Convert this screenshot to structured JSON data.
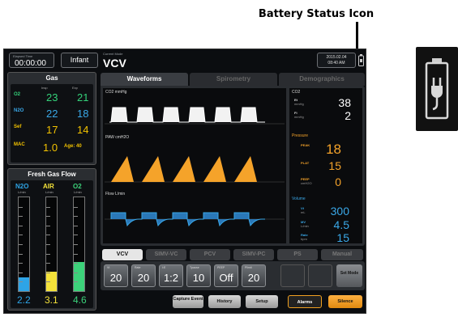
{
  "annotation": {
    "label": "Battery Status Icon"
  },
  "header": {
    "elapsed_label": "Elapsed Time",
    "elapsed_value": "00:00:00",
    "patient_type": "Infant",
    "mode_label": "Current Mode",
    "mode_value": "VCV",
    "date": "2015.02.04",
    "time": "08:40 AM"
  },
  "gas": {
    "title": "Gas",
    "col_insp": "Insp",
    "col_exp": "Exp",
    "rows": [
      {
        "name": "O2",
        "unit": "%",
        "insp": "23",
        "exp": "21",
        "color": "#34d27a"
      },
      {
        "name": "N2O",
        "unit": "%",
        "insp": "22",
        "exp": "18",
        "color": "#3aa8e8"
      },
      {
        "name": "Sef",
        "unit": "%",
        "insp": "17",
        "exp": "14",
        "color": "#f2c200"
      }
    ],
    "mac_label": "MAC",
    "mac_value": "1.0",
    "age_label": "Age: 40"
  },
  "fresh_gas_flow": {
    "title": "Fresh Gas Flow",
    "unit": "L/min",
    "tubes": [
      {
        "name": "N2O",
        "value": "2.2",
        "level": 0.15,
        "color": "#2ea4e6"
      },
      {
        "name": "AIR",
        "value": "3.1",
        "level": 0.21,
        "color": "#f4e23a"
      },
      {
        "name": "O2",
        "value": "4.6",
        "level": 0.31,
        "color": "#3cd27a"
      }
    ]
  },
  "tabs": [
    "Waveforms",
    "Spirometry",
    "Demographics"
  ],
  "waveforms": [
    {
      "title": "CO2 mmHg",
      "color": "#ffffff"
    },
    {
      "title": "PAW cmH2O",
      "color": "#f5a32a"
    },
    {
      "title": "Flow L/min",
      "color": "#3aa8e8"
    }
  ],
  "readouts": {
    "co2": {
      "title": "CO2",
      "et_label": "Et",
      "et_unit": "mmHg",
      "et_value": "38",
      "fi_label": "Fi",
      "fi_unit": "mmHg",
      "fi_value": "2"
    },
    "pressure": {
      "title": "Pressure",
      "peak_label": "PEAK",
      "peak_value": "18",
      "plat_label": "PLAT",
      "plat_value": "15",
      "peep_label": "PEEP",
      "peep_value": "0",
      "unit": "cmH2O"
    },
    "volume": {
      "title": "Volume",
      "vt_label": "Vt",
      "vt_unit": "mL",
      "vt_value": "300",
      "mv_label": "MV",
      "mv_unit": "L/min",
      "mv_value": "4.5",
      "rate_label": "Rate",
      "rate_unit": "bpm",
      "rate_value": "15"
    }
  },
  "modes": [
    "VCV",
    "SIMV-VC",
    "PCV",
    "SIMV-PC",
    "PS",
    "Manual"
  ],
  "settings": [
    {
      "label": "Vt",
      "value": "20"
    },
    {
      "label": "Rate",
      "value": "20"
    },
    {
      "label": "I:E",
      "value": "1:2"
    },
    {
      "label": "Tpause",
      "value": "10"
    },
    {
      "label": "PEEP",
      "value": "Off"
    },
    {
      "label": "Plimit",
      "value": "20"
    }
  ],
  "set_mode_label": "Set Mode",
  "bottom_buttons": {
    "capture": "Capture Event",
    "history": "History",
    "setup": "Setup",
    "alarms": "Alarms",
    "silence": "Silence"
  },
  "colors": {
    "accent": "#f5a32a",
    "pressure": "#f5a32a",
    "volume": "#3aa8e8"
  }
}
